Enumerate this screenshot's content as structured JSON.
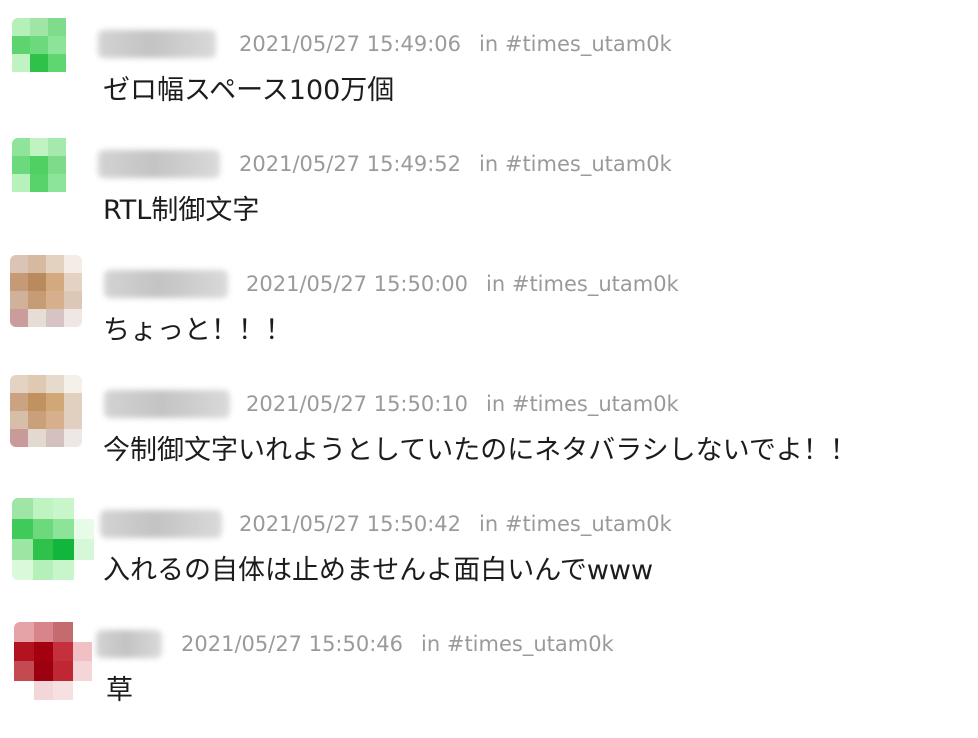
{
  "messages": [
    {
      "timestamp": "2021/05/27 15:49:06",
      "channel": "in #times_utam0k",
      "text": "ゼロ幅スペース100万個",
      "avatar_colors": [
        "#b5f0ba",
        "#9fe6a6",
        "#7fdc8a",
        "#ffffff",
        "#5dd46e",
        "#6bd97c",
        "#8ce498",
        "#ffffff",
        "#bff3c2",
        "#2fc24b",
        "#5fd670",
        "#ffffff",
        "#ffffff",
        "#ffffff",
        "#ffffff",
        "#ffffff"
      ]
    },
    {
      "timestamp": "2021/05/27 15:49:52",
      "channel": "in #times_utam0k",
      "text": "RTL制御文字",
      "avatar_colors": [
        "#8fe39a",
        "#bff3c2",
        "#a5eaac",
        "#ffffff",
        "#6bd97c",
        "#4fd063",
        "#7ddc89",
        "#ffffff",
        "#b7f1bc",
        "#58d26b",
        "#8ce498",
        "#ffffff",
        "#ffffff",
        "#ffffff",
        "#ffffff",
        "#ffffff"
      ]
    },
    {
      "timestamp": "2021/05/27 15:50:00",
      "channel": "in #times_utam0k",
      "text": "ちょっと！！！",
      "avatar_colors": [
        "#dbc3b5",
        "#d7b9a0",
        "#e3d2c0",
        "#f3ede6",
        "#c79a77",
        "#b98a5e",
        "#d3aa7f",
        "#e4d3c3",
        "#d0b29a",
        "#c59c74",
        "#d6b08c",
        "#ddc8b8",
        "#cc9c9c",
        "#e6ddd5",
        "#d7c3c3",
        "#efe7e4"
      ]
    },
    {
      "timestamp": "2021/05/27 15:50:10",
      "channel": "in #times_utam0k",
      "text": "今制御文字いれようとしていたのにネタバラシしないでよ！！",
      "avatar_colors": [
        "#e4d3c3",
        "#dfc9b2",
        "#e6dacc",
        "#f5f0ea",
        "#cba282",
        "#c0925f",
        "#d2a777",
        "#e2d0bf",
        "#d7bea9",
        "#c9a079",
        "#d6b08c",
        "#e1cfc0",
        "#c99a9a",
        "#e4d9d0",
        "#d4c0bd",
        "#efe7e4"
      ]
    },
    {
      "timestamp": "2021/05/27 15:50:42",
      "channel": "in #times_utam0k",
      "text": "入れるの自体は止めませんよ面白いんでwww",
      "avatar_colors": [
        "#9fe6a6",
        "#bff3c2",
        "#c8f6ca",
        "#ffffff",
        "#3fca5a",
        "#6bd97c",
        "#8ce498",
        "#e8fbe9",
        "#9be6a3",
        "#2fc24b",
        "#13b63d",
        "#d6f8d8",
        "#d9f9db",
        "#b5f0ba",
        "#c8f6ca",
        "#ffffff"
      ]
    },
    {
      "timestamp": "2021/05/27 15:50:46",
      "channel": "in #times_utam0k",
      "text": "草",
      "avatar_colors": [
        "#e5a3a8",
        "#d9848b",
        "#c56a6e",
        "#ffffff",
        "#b3121f",
        "#a50010",
        "#c4313c",
        "#f0c0c4",
        "#c44a52",
        "#9d0010",
        "#bf2732",
        "#f4d6d8",
        "#ffffff",
        "#f2d6d8",
        "#f6e0e2",
        "#ffffff"
      ]
    }
  ]
}
